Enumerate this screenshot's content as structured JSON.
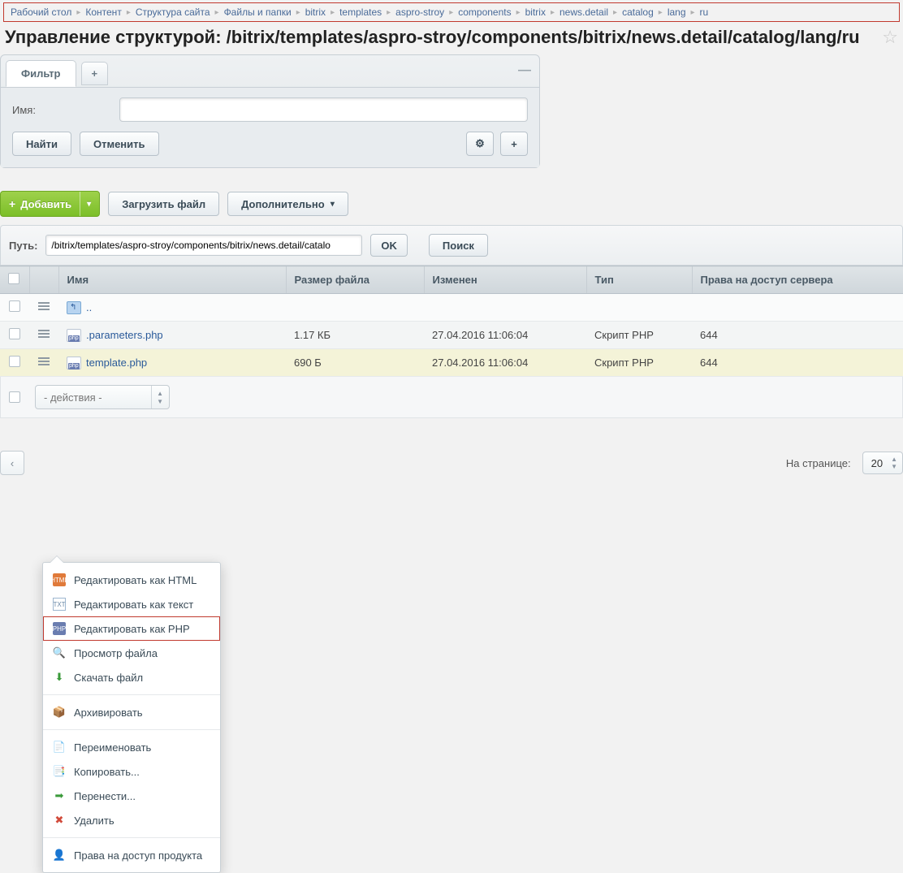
{
  "breadcrumb": [
    "Рабочий стол",
    "Контент",
    "Структура сайта",
    "Файлы и папки",
    "bitrix",
    "templates",
    "aspro-stroy",
    "components",
    "bitrix",
    "news.detail",
    "catalog",
    "lang",
    "ru"
  ],
  "page_title": "Управление структурой: /bitrix/templates/aspro-stroy/components/bitrix/news.detail/catalog/lang/ru",
  "filter": {
    "tab_label": "Фильтр",
    "add_tab": "+",
    "name_label": "Имя:",
    "name_value": "",
    "find": "Найти",
    "cancel": "Отменить",
    "gear": "⚙",
    "plus": "+"
  },
  "toolbar": {
    "add": "Добавить",
    "upload": "Загрузить файл",
    "more": "Дополнительно"
  },
  "path_bar": {
    "label": "Путь:",
    "value": "/bitrix/templates/aspro-stroy/components/bitrix/news.detail/catalo",
    "ok": "OK",
    "search": "Поиск"
  },
  "columns": {
    "name": "Имя",
    "size": "Размер файла",
    "modified": "Изменен",
    "type": "Тип",
    "perm": "Права на доступ сервера"
  },
  "rows": [
    {
      "name": "..",
      "size": "",
      "modified": "",
      "type": "",
      "perm": "",
      "icon": "folder-up"
    },
    {
      "name": ".parameters.php",
      "size": "1.17 КБ",
      "modified": "27.04.2016 11:06:04",
      "type": "Скрипт PHP",
      "perm": "644",
      "icon": "php"
    },
    {
      "name": "template.php",
      "size": "690 Б",
      "modified": "27.04.2016 11:06:04",
      "type": "Скрипт PHP",
      "perm": "644",
      "icon": "php",
      "highlight": true
    }
  ],
  "selector_placeholder": "- действия -",
  "pager": {
    "prev": "‹",
    "label": "На странице:",
    "size": "20"
  },
  "ctx": {
    "edit_html": "Редактировать как HTML",
    "edit_text": "Редактировать как текст",
    "edit_php": "Редактировать как PHP",
    "view_file": "Просмотр файла",
    "download": "Скачать файл",
    "archive": "Архивировать",
    "rename": "Переименовать",
    "copy": "Копировать...",
    "move": "Перенести...",
    "delete": "Удалить",
    "product_perm": "Права на доступ продукта"
  }
}
